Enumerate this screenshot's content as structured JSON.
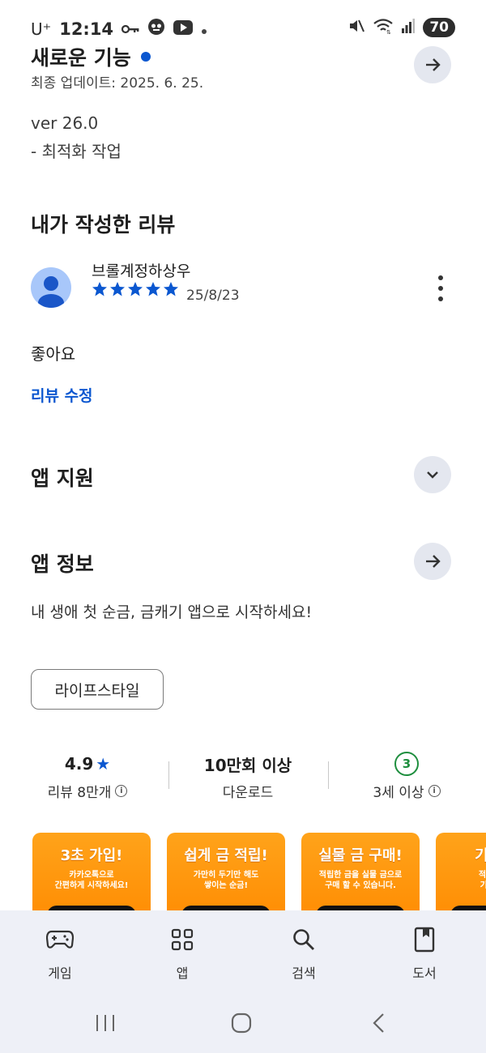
{
  "status_bar": {
    "carrier": "U⁺",
    "time": "12:14",
    "battery": "70"
  },
  "whats_new": {
    "title": "새로운 기능",
    "updated": "최종 업데이트: 2025. 6. 25.",
    "version": "ver 26.0",
    "note": "- 최적화 작업"
  },
  "my_review": {
    "title": "내가 작성한 리뷰",
    "author": "브롤계정하상우",
    "stars": 5,
    "date": "25/8/23",
    "text": "좋아요",
    "edit_link": "리뷰 수정"
  },
  "app_support": {
    "title": "앱 지원"
  },
  "app_info": {
    "title": "앱 정보",
    "description": "내 생애 첫 순금, 금캐기 앱으로 시작하세요!",
    "category_chip": "라이프스타일"
  },
  "stats": {
    "rating": "4.9",
    "rating_label": "리뷰 8만개",
    "downloads": "10만회 이상",
    "downloads_label": "다운로드",
    "age_badge": "3",
    "age_label": "3세 이상"
  },
  "screenshots": [
    {
      "title": "3초 가입!",
      "desc": "카카오톡으로\n간편하게 시작하세요!"
    },
    {
      "title": "쉽게 금 적립!",
      "desc": "가만히 두기만 해도\n쌓이는 순금!"
    },
    {
      "title": "실물 금 구매!",
      "desc": "적립한 금을 실물 금으로\n구매 할 수 있습니다."
    },
    {
      "title": "기프티",
      "desc": "적립한 금\n기프티콘"
    }
  ],
  "bottom_nav": {
    "games": "게임",
    "apps": "앱",
    "search": "검색",
    "books": "도서"
  },
  "colors": {
    "accent_blue": "#0b57d0",
    "button_bg": "#e4e7ef",
    "nav_bg": "#eef0f7",
    "green": "#1e8e3e",
    "orange": "#ff9800"
  }
}
